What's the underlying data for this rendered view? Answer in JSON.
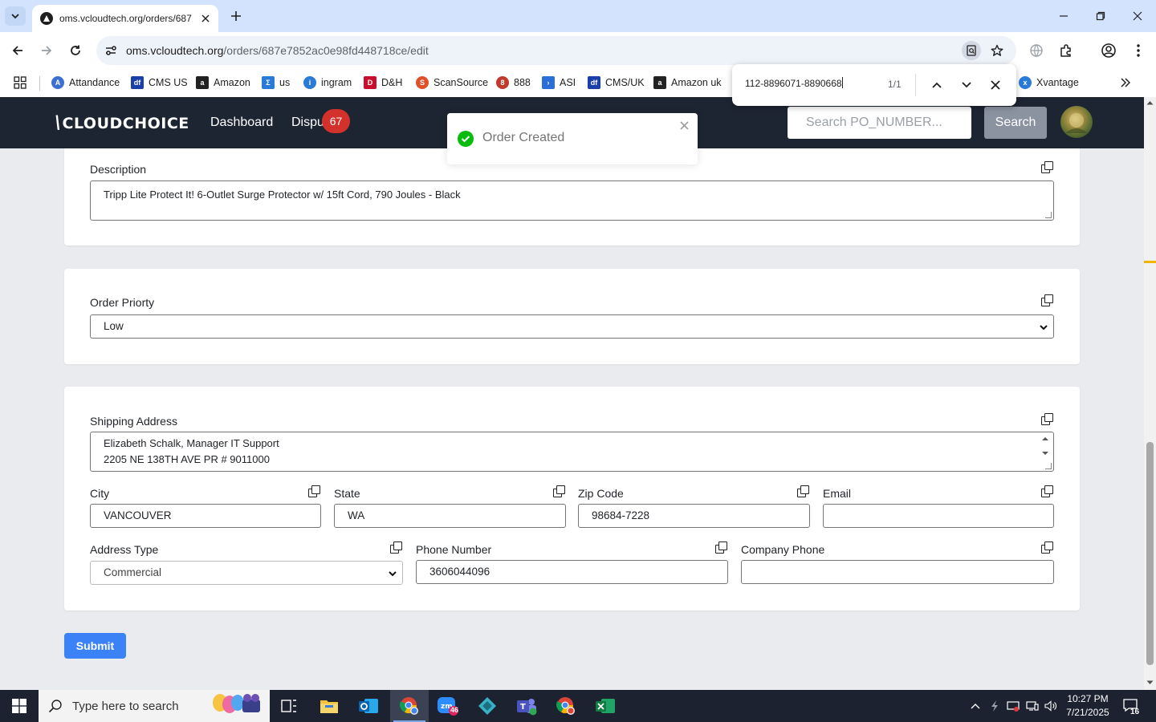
{
  "browser": {
    "tab_title": "oms.vcloudtech.org/orders/687",
    "url_host": "oms.vcloudtech.org",
    "url_path": "/orders/687e7852ac0e98fd448718ce/edit",
    "bookmarks": [
      {
        "label": "Attandance",
        "icon": "bookmark-attandance-icon",
        "color": "#3b6fd1"
      },
      {
        "label": "CMS US",
        "icon": "bookmark-cms-icon",
        "color": "#1a3fa8"
      },
      {
        "label": "Amazon",
        "icon": "amazon-icon",
        "color": "#222222"
      },
      {
        "label": "us",
        "icon": "bookmark-us-icon",
        "color": "#2a7ad8"
      },
      {
        "label": "ingram",
        "icon": "ingram-icon",
        "color": "#2a7ad8"
      },
      {
        "label": "D&H",
        "icon": "dh-icon",
        "color": "#c8102e"
      },
      {
        "label": "ScanSource",
        "icon": "scansource-icon",
        "color": "#e0502a"
      },
      {
        "label": "888",
        "icon": "bookmark-888-icon",
        "color": "#c0392b"
      },
      {
        "label": "ASI",
        "icon": "asi-icon",
        "color": "#2a6fd8"
      },
      {
        "label": "CMS/UK",
        "icon": "bookmark-cms-uk-icon",
        "color": "#1a3fa8"
      },
      {
        "label": "Amazon uk",
        "icon": "amazon-icon",
        "color": "#222222"
      },
      {
        "label": "Xvantage",
        "icon": "xvantage-icon",
        "color": "#2a7ad8"
      }
    ]
  },
  "findbar": {
    "query": "112-8896071-8890668",
    "count": "1/1"
  },
  "header": {
    "logo": "CLOUDCHOICE",
    "nav": {
      "dashboard": "Dashboard",
      "disputes": "Dispu",
      "disputes_badge": "67"
    },
    "search_placeholder": "Search PO_NUMBER...",
    "search_button": "Search"
  },
  "toast": {
    "message": "Order Created"
  },
  "form": {
    "description": {
      "label": "Description",
      "value": "Tripp Lite Protect It! 6-Outlet Surge Protector w/ 15ft Cord, 790 Joules - Black"
    },
    "order_priority": {
      "label": "Order Priorty",
      "value": "Low"
    },
    "shipping_address": {
      "label": "Shipping Address",
      "line1": "Elizabeth Schalk, Manager IT Support",
      "line2": "2205 NE 138TH AVE PR # 9011000"
    },
    "city": {
      "label": "City",
      "value": "VANCOUVER"
    },
    "state": {
      "label": "State",
      "value": "WA"
    },
    "zip": {
      "label": "Zip Code",
      "value": "98684-7228"
    },
    "email": {
      "label": "Email",
      "value": ""
    },
    "address_type": {
      "label": "Address Type",
      "value": "Commercial"
    },
    "phone": {
      "label": "Phone Number",
      "value": "3606044096"
    },
    "company_phone": {
      "label": "Company Phone",
      "value": ""
    },
    "submit": "Submit"
  },
  "taskbar": {
    "search_placeholder": "Type here to search",
    "time": "10:27 PM",
    "date": "7/21/2025",
    "zoom_badge": "46",
    "notification_count": "16"
  }
}
